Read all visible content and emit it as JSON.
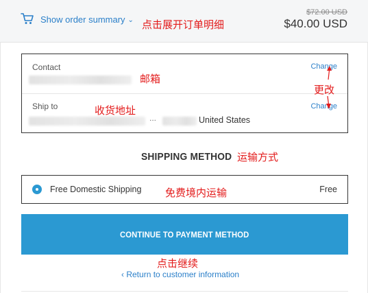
{
  "header": {
    "summary_toggle_label": "Show order summary",
    "original_price": "$72.00 USD",
    "total_price": "$40.00 USD"
  },
  "contact": {
    "label": "Contact",
    "change_label": "Change"
  },
  "ship_to": {
    "label": "Ship to",
    "ellipsis": "...",
    "country": "United States",
    "change_label": "Change"
  },
  "shipping_method": {
    "title": "SHIPPING METHOD",
    "option_name": "Free Domestic Shipping",
    "option_price": "Free",
    "selected": true
  },
  "actions": {
    "continue_label": "CONTINUE TO PAYMENT METHOD",
    "return_label": "Return to customer information"
  },
  "annotations": {
    "summary_note": "点击展开订单明细",
    "email_note": "邮箱",
    "change_note": "更改",
    "address_note": "收货地址",
    "method_note": "运输方式",
    "free_shipping_note": "免费境内运输",
    "continue_note": "点击继续"
  },
  "colors": {
    "accent_blue": "#2b99d2",
    "link_blue": "#2a7fc9",
    "annotation_red": "#e31b1b",
    "header_bg": "#f5f6f7"
  },
  "icons": {
    "cart": "cart-icon",
    "expand": "chevron-down-icon",
    "back": "chevron-left-icon"
  }
}
